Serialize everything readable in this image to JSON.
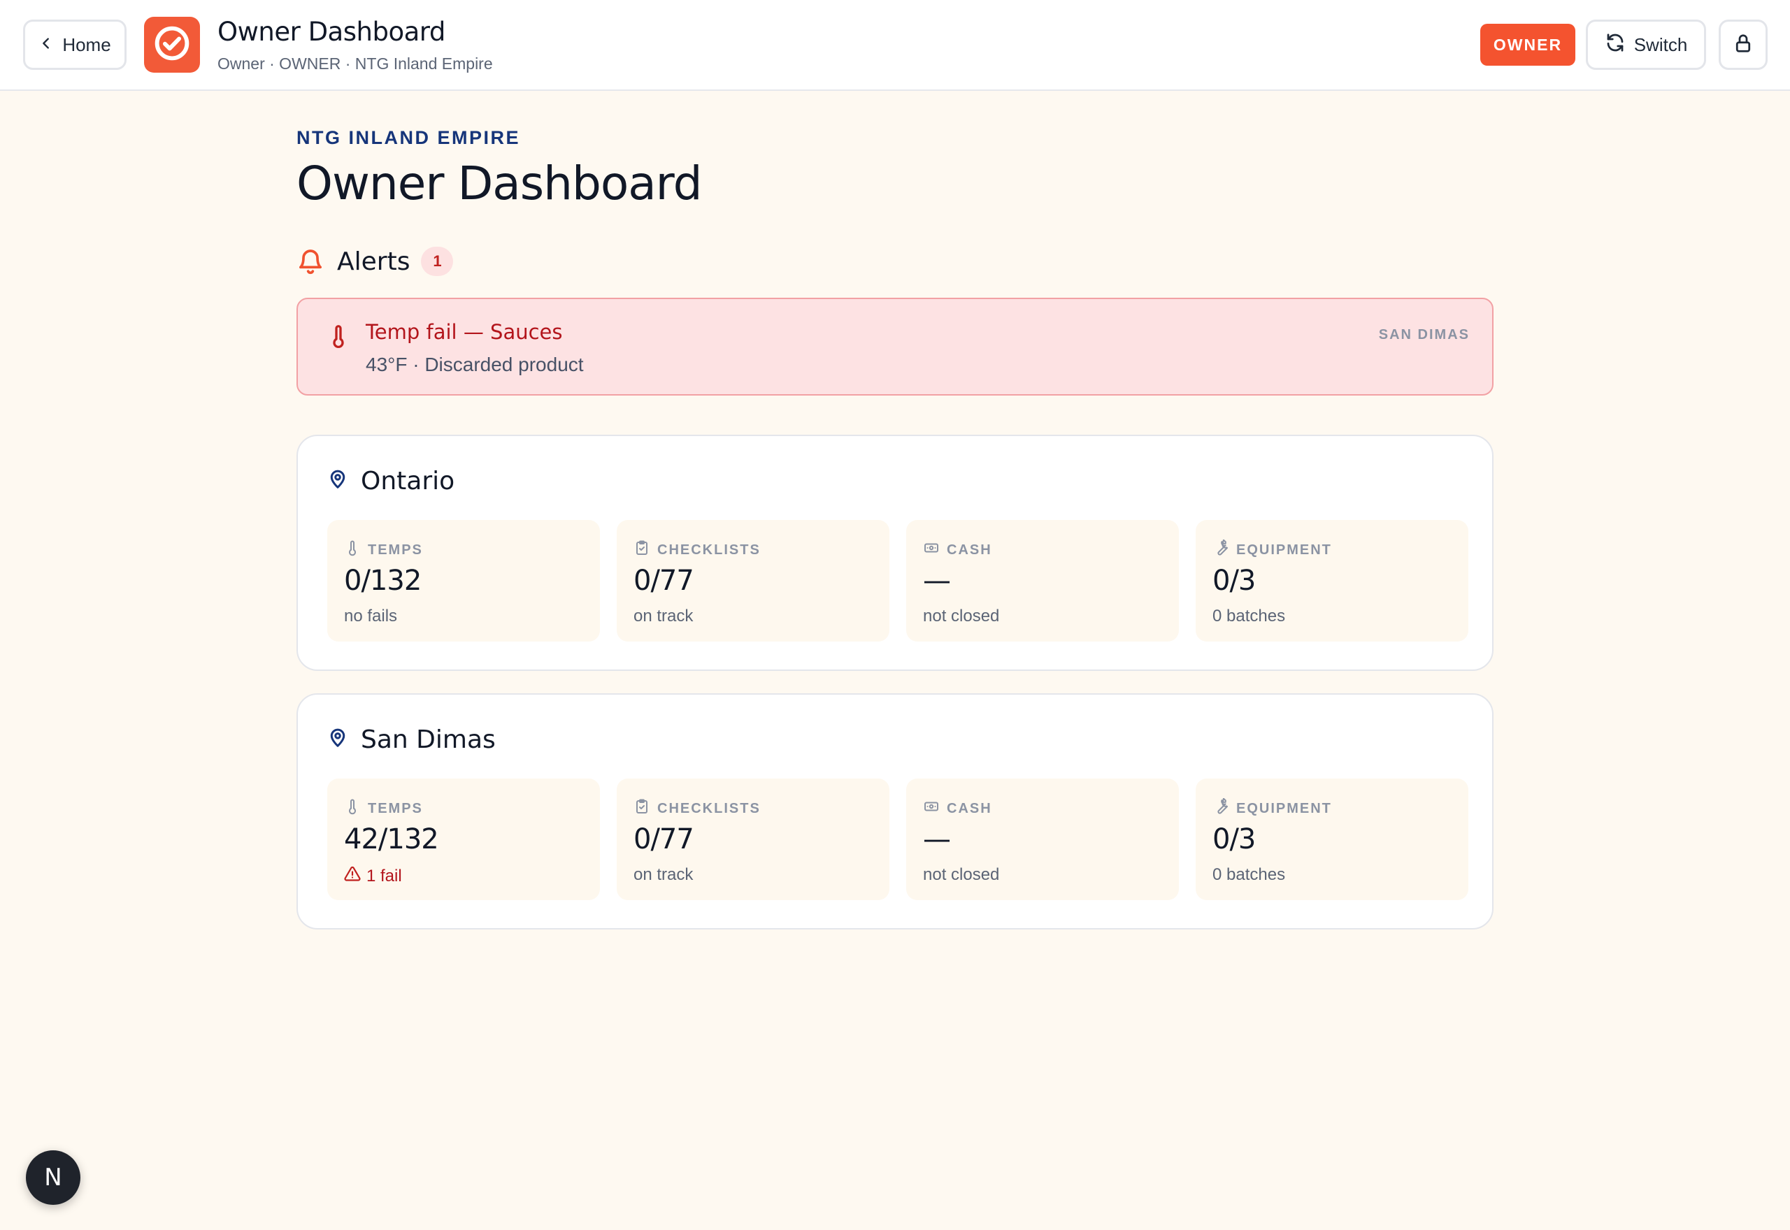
{
  "header": {
    "home_label": "Home",
    "title": "Owner Dashboard",
    "subtitle": "Owner · OWNER · NTG Inland Empire",
    "role_badge": "OWNER",
    "switch_label": "Switch"
  },
  "main": {
    "org_label": "NTG INLAND EMPIRE",
    "page_title": "Owner Dashboard",
    "alerts_label": "Alerts",
    "alerts_count": "1",
    "alerts": [
      {
        "title": "Temp fail — Sauces",
        "detail": "43°F · Discarded product",
        "location": "SAN DIMAS"
      }
    ],
    "locations": [
      {
        "name": "Ontario",
        "tiles": [
          {
            "label": "TEMPS",
            "value": "0/132",
            "sub": "no fails"
          },
          {
            "label": "CHECKLISTS",
            "value": "0/77",
            "sub": "on track"
          },
          {
            "label": "CASH",
            "value": "—",
            "sub": "not closed"
          },
          {
            "label": "EQUIPMENT",
            "value": "0/3",
            "sub": "0 batches"
          }
        ]
      },
      {
        "name": "San Dimas",
        "tiles": [
          {
            "label": "TEMPS",
            "value": "42/132",
            "sub": "1 fail"
          },
          {
            "label": "CHECKLISTS",
            "value": "0/77",
            "sub": "on track"
          },
          {
            "label": "CASH",
            "value": "—",
            "sub": "not closed"
          },
          {
            "label": "EQUIPMENT",
            "value": "0/3",
            "sub": "0 batches"
          }
        ]
      }
    ]
  },
  "dev_badge": "N",
  "colors": {
    "brand": "#f25a38",
    "navy": "#16357a",
    "alert_bg": "#fde2e3",
    "alert_text": "#b3151c",
    "page_bg": "#fef9f1"
  },
  "icons": [
    "chevron-left-icon",
    "check-circle-icon",
    "refresh-icon",
    "lock-icon",
    "bell-icon",
    "thermometer-icon",
    "map-pin-icon",
    "clipboard-check-icon",
    "banknote-icon",
    "wrench-icon",
    "alert-triangle-icon"
  ]
}
